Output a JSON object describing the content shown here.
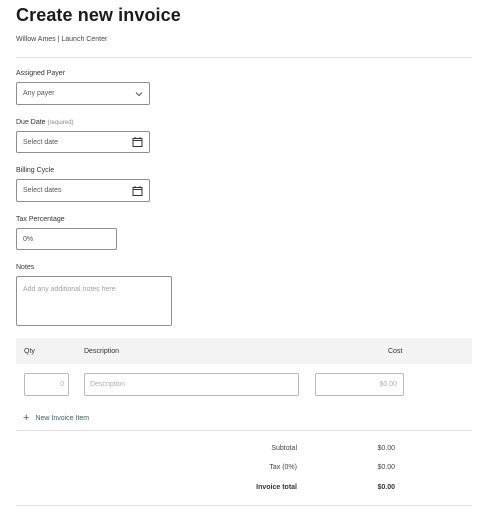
{
  "header": {
    "title": "Create new invoice",
    "subtitle": "Willow Ames | Launch Center"
  },
  "form": {
    "assigned_payer": {
      "label": "Assigned Payer",
      "value": "Any payer"
    },
    "due_date": {
      "label": "Due Date",
      "required_note": "(required)",
      "placeholder": "Select date"
    },
    "billing_cycle": {
      "label": "Billing Cycle",
      "placeholder": "Select dates"
    },
    "tax_percentage": {
      "label": "Tax Percentage",
      "value": "0%"
    },
    "notes": {
      "label": "Notes",
      "placeholder": "Add any additional notes here"
    }
  },
  "items_table": {
    "columns": {
      "qty": "Qty",
      "description": "Description",
      "cost": "Cost"
    },
    "row": {
      "qty_value": "0",
      "description_placeholder": "Description",
      "cost_placeholder": "$0.00"
    },
    "new_item_label": "New Invoice Item"
  },
  "totals": {
    "subtotal_label": "Subtotal",
    "subtotal_value": "$0.00",
    "tax_label": "Tax (0%)",
    "tax_value": "$0.00",
    "total_label": "Invoice total",
    "total_value": "$0.00"
  },
  "icons": {
    "dropdown": "chevron-down-icon",
    "calendar": "calendar-icon",
    "add": "plus-icon"
  },
  "colors": {
    "accent": "#2d6b5f",
    "table_header_bg": "#f3f3f3"
  }
}
